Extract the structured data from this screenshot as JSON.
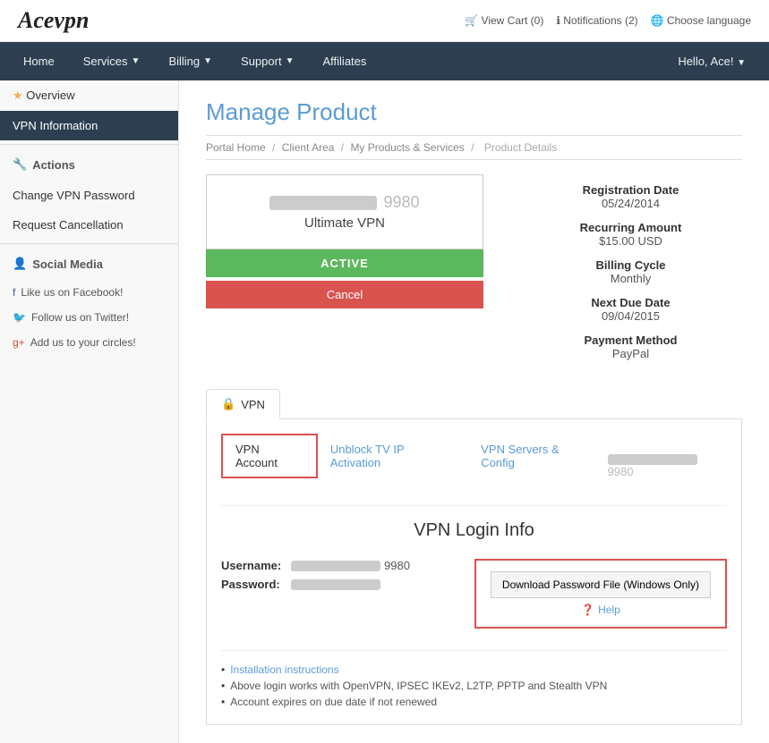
{
  "topbar": {
    "logo": "Acevpn",
    "cart_label": "View Cart (0)",
    "notifications_label": "Notifications (2)",
    "language_label": "Choose language"
  },
  "nav": {
    "items": [
      {
        "label": "Home"
      },
      {
        "label": "Services",
        "has_dropdown": true
      },
      {
        "label": "Billing",
        "has_dropdown": true
      },
      {
        "label": "Support",
        "has_dropdown": true
      },
      {
        "label": "Affiliates"
      }
    ],
    "user_label": "Hello, Ace!"
  },
  "sidebar": {
    "overview_label": "Overview",
    "vpn_info_label": "VPN Information",
    "actions_label": "Actions",
    "actions": [
      {
        "label": "Change VPN Password"
      },
      {
        "label": "Request Cancellation"
      }
    ],
    "social_label": "Social Media",
    "social_items": [
      {
        "label": "Like us on Facebook!"
      },
      {
        "label": "Follow us on Twitter!"
      },
      {
        "label": "Add us to your circles!"
      }
    ]
  },
  "breadcrumb": {
    "items": [
      {
        "label": "Portal Home"
      },
      {
        "label": "Client Area"
      },
      {
        "label": "My Products & Services"
      },
      {
        "label": "Product Details"
      }
    ]
  },
  "page_title": "Manage Product",
  "product": {
    "id_suffix": "9980",
    "name": "Ultimate VPN",
    "status": "ACTIVE",
    "cancel_label": "Cancel"
  },
  "details": {
    "registration_date_label": "Registration Date",
    "registration_date": "05/24/2014",
    "recurring_amount_label": "Recurring Amount",
    "recurring_amount": "$15.00 USD",
    "billing_cycle_label": "Billing Cycle",
    "billing_cycle": "Monthly",
    "next_due_date_label": "Next Due Date",
    "next_due_date": "09/04/2015",
    "payment_method_label": "Payment Method",
    "payment_method": "PayPal"
  },
  "vpn_tab": {
    "tab_label": "VPN",
    "account_id_suffix": "9980",
    "sub_tabs": [
      {
        "label": "VPN Account"
      },
      {
        "label": "Unblock TV IP Activation"
      },
      {
        "label": "VPN Servers & Config"
      }
    ]
  },
  "vpn_login": {
    "title": "VPN Login Info",
    "username_label": "Username:",
    "username_suffix": "9980",
    "password_label": "Password:",
    "download_btn_label": "Download Password File (Windows Only)",
    "help_label": "Help"
  },
  "notes": {
    "items": [
      {
        "label": "Installation instructions",
        "link": true
      },
      {
        "label": "Above login works with OpenVPN, IPSEC IKEv2, L2TP, PPTP and Stealth VPN",
        "link": false
      },
      {
        "label": "Account expires on due date if not renewed",
        "link": false
      }
    ]
  }
}
